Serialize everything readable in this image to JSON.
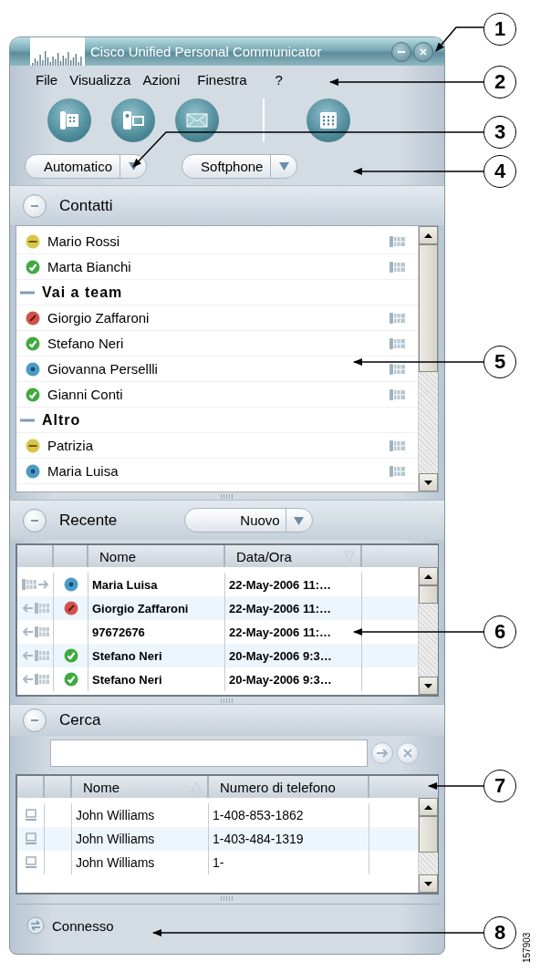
{
  "window": {
    "title": "Cisco Unified Personal Communicator"
  },
  "menu": [
    {
      "label": "File"
    },
    {
      "label": "Visualizza"
    },
    {
      "label": "Azioni"
    },
    {
      "label": "Finestra"
    },
    {
      "label": "?"
    }
  ],
  "toolbar": [
    {
      "kind": "phone"
    },
    {
      "kind": "video"
    },
    {
      "kind": "mail"
    },
    {
      "kind": "separator"
    },
    {
      "kind": "keypad"
    }
  ],
  "presence_dropdown": {
    "label": "Automatico"
  },
  "device_dropdown": {
    "label": "Softphone"
  },
  "contacts": {
    "title": "Contatti",
    "expanded": true,
    "items": [
      {
        "kind": "contact",
        "name": "Mario Rossi",
        "color": "#d9c54a"
      },
      {
        "kind": "contact",
        "name": "Marta Bianchi",
        "color": "#3faa3f"
      },
      {
        "kind": "group",
        "name": "Vai a team",
        "expanded": true,
        "children": [
          {
            "kind": "contact",
            "name": "Giorgio Zaffaroni",
            "color": "#d0534c"
          },
          {
            "kind": "contact",
            "name": "Stefano Neri",
            "color": "#3faa3f"
          },
          {
            "kind": "contact",
            "name": "Giovanna Persellli",
            "color": "#4a9cc2"
          },
          {
            "kind": "contact",
            "name": "Gianni Conti",
            "color": "#3faa3f"
          }
        ]
      },
      {
        "kind": "group",
        "name": "Altro",
        "expanded": true,
        "children": [
          {
            "kind": "contact",
            "name": "Patrizia",
            "color": "#d9c54a"
          },
          {
            "kind": "contact",
            "name": "Maria Luisa",
            "color": "#4a9cc2"
          }
        ]
      }
    ]
  },
  "recent": {
    "title": "Recente",
    "expanded": true,
    "new_button": "Nuovo",
    "columns": [
      {
        "label": "Nome",
        "sorted": false
      },
      {
        "label": "Data/Ora",
        "sorted": true,
        "descending": true
      }
    ],
    "rows": [
      {
        "outgoing": true,
        "color": "#4a9cc2",
        "name": "Maria Luisa",
        "time": "22-May-2006 11:…"
      },
      {
        "outgoing": false,
        "color": "#d0534c",
        "name": "Giorgio Zaffaroni",
        "time": "22-May-2006 11:…"
      },
      {
        "outgoing": false,
        "name": "97672676",
        "time": "22-May-2006 11:…"
      },
      {
        "outgoing": false,
        "color": "#3faa3f",
        "name": "Stefano Neri",
        "time": "20-May-2006 9:3…"
      },
      {
        "outgoing": false,
        "color": "#3faa3f",
        "name": "Stefano Neri",
        "time": "20-May-2006 9:3…"
      }
    ]
  },
  "search": {
    "title": "Cerca",
    "expanded": true,
    "columns": [
      {
        "label": "Nome",
        "sorted": true,
        "descending": false
      },
      {
        "label": "Numero di telefono",
        "sorted": false
      }
    ],
    "rows": [
      {
        "name": "John Williams",
        "phone": "1-408-853-1862"
      },
      {
        "name": "John Williams",
        "phone": "1-403-484-1319"
      },
      {
        "name": "John Williams",
        "phone": "1-"
      }
    ]
  },
  "status_bar": {
    "text": "Connesso"
  },
  "callouts": [
    {
      "number": "1"
    },
    {
      "number": "2"
    },
    {
      "number": "3"
    },
    {
      "number": "4"
    },
    {
      "number": "5"
    },
    {
      "number": "6"
    },
    {
      "number": "7"
    },
    {
      "number": "8"
    }
  ],
  "figure_id": "157903"
}
